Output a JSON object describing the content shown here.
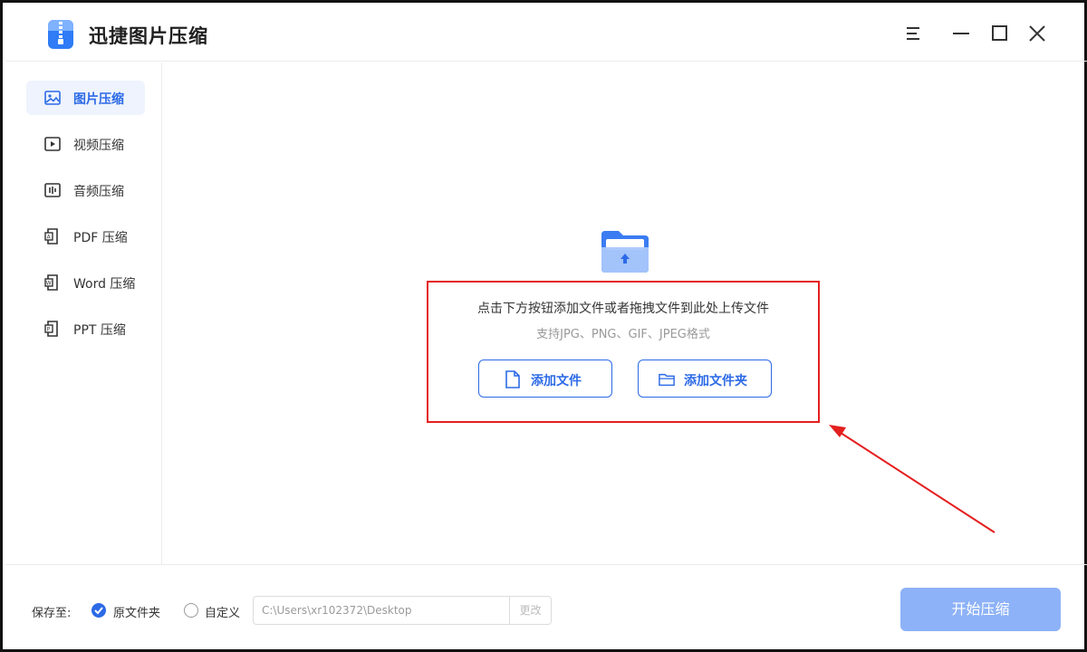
{
  "app": {
    "title": "迅捷图片压缩",
    "logo_icon": "zip-file-logo-icon"
  },
  "window_controls": [
    {
      "name": "menu-button",
      "icon": "hamburger-icon"
    },
    {
      "name": "minimize-button",
      "icon": "minimize-icon"
    },
    {
      "name": "maximize-button",
      "icon": "maximize-icon"
    },
    {
      "name": "close-button",
      "icon": "close-icon"
    }
  ],
  "sidebar": {
    "items": [
      {
        "label": "图片压缩",
        "icon": "image-icon",
        "active": true
      },
      {
        "label": "视频压缩",
        "icon": "video-icon",
        "active": false
      },
      {
        "label": "音频压缩",
        "icon": "audio-icon",
        "active": false
      },
      {
        "label": "PDF 压缩",
        "icon": "pdf-icon",
        "active": false
      },
      {
        "label": "Word 压缩",
        "icon": "word-icon",
        "active": false
      },
      {
        "label": "PPT 压缩",
        "icon": "ppt-icon",
        "active": false
      }
    ]
  },
  "upload": {
    "icon": "folder-upload-icon",
    "hint": "点击下方按钮添加文件或者拖拽文件到此处上传文件",
    "formats": "支持JPG、PNG、GIF、JPEG格式",
    "add_file_label": "添加文件",
    "add_folder_label": "添加文件夹"
  },
  "bottom": {
    "save_to_label": "保存至:",
    "option_original": "原文件夹",
    "option_custom": "自定义",
    "selected_option": "原文件夹",
    "path_value": "C:\\Users\\xr102372\\Desktop",
    "change_label": "更改",
    "start_label": "开始压缩"
  },
  "colors": {
    "accent": "#2c6ae6",
    "active_bg": "#eef3fd",
    "start_button_disabled": "#8db2f7",
    "annotation_red": "#e41f1f"
  }
}
